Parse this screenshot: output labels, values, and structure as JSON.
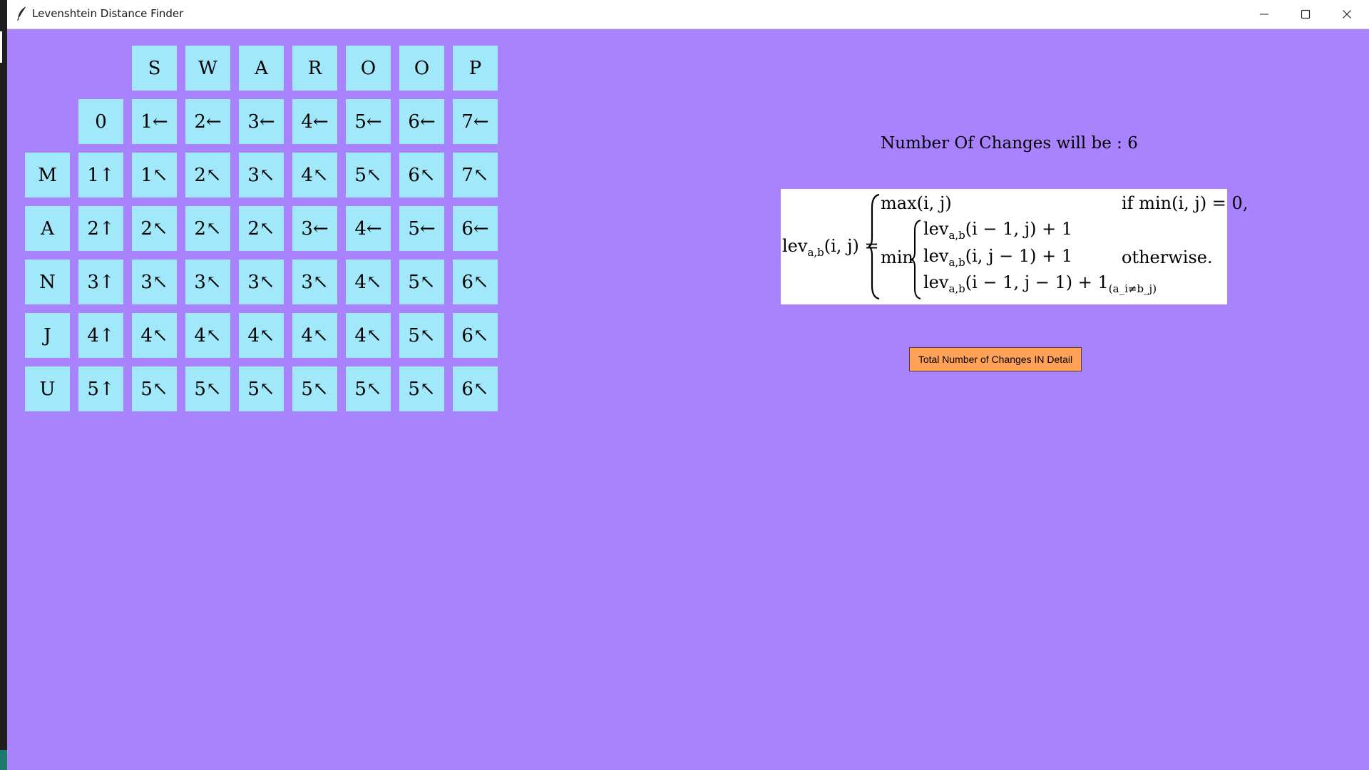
{
  "window": {
    "title": "Levenshtein Distance Finder",
    "app_icon": "feather-icon"
  },
  "controls": {
    "minimize": "minimize-icon",
    "maximize": "maximize-icon",
    "close": "close-icon"
  },
  "matrix": {
    "column_headers": [
      "S",
      "W",
      "A",
      "R",
      "O",
      "O",
      "P"
    ],
    "rows": [
      {
        "label": "",
        "cells": [
          "0",
          "1←",
          "2←",
          "3←",
          "4←",
          "5←",
          "6←",
          "7←"
        ]
      },
      {
        "label": "M",
        "cells": [
          "1↑",
          "1↖",
          "2↖",
          "3↖",
          "4↖",
          "5↖",
          "6↖",
          "7↖"
        ]
      },
      {
        "label": "A",
        "cells": [
          "2↑",
          "2↖",
          "2↖",
          "2↖",
          "3←",
          "4←",
          "5←",
          "6←"
        ]
      },
      {
        "label": "N",
        "cells": [
          "3↑",
          "3↖",
          "3↖",
          "3↖",
          "3↖",
          "4↖",
          "5↖",
          "6↖"
        ]
      },
      {
        "label": "J",
        "cells": [
          "4↑",
          "4↖",
          "4↖",
          "4↖",
          "4↖",
          "4↖",
          "5↖",
          "6↖"
        ]
      },
      {
        "label": "U",
        "cells": [
          "5↑",
          "5↖",
          "5↖",
          "5↖",
          "5↖",
          "5↖",
          "5↖",
          "6↖"
        ]
      }
    ]
  },
  "result": {
    "text": "Number Of Changes will be : 6"
  },
  "formula": {
    "lev": "lev",
    "subscript_ab": "a,b",
    "args_ij": "(i, j) =",
    "case1_expr": "max(i, j)",
    "case1_cond": "if min(i, j) = 0,",
    "min_label": "min",
    "term1": "(i − 1, j) + 1",
    "term2": "(i, j − 1) + 1",
    "term3": "(i − 1, j − 1) + 1",
    "indicator_sub": "(a_i≠b_j)",
    "case2_cond": "otherwise."
  },
  "detail_button": {
    "label": "Total Number of Changes IN Detail"
  },
  "colors": {
    "background": "#a982fd",
    "cell": "#a0e8fa",
    "button": "#ffa257"
  }
}
